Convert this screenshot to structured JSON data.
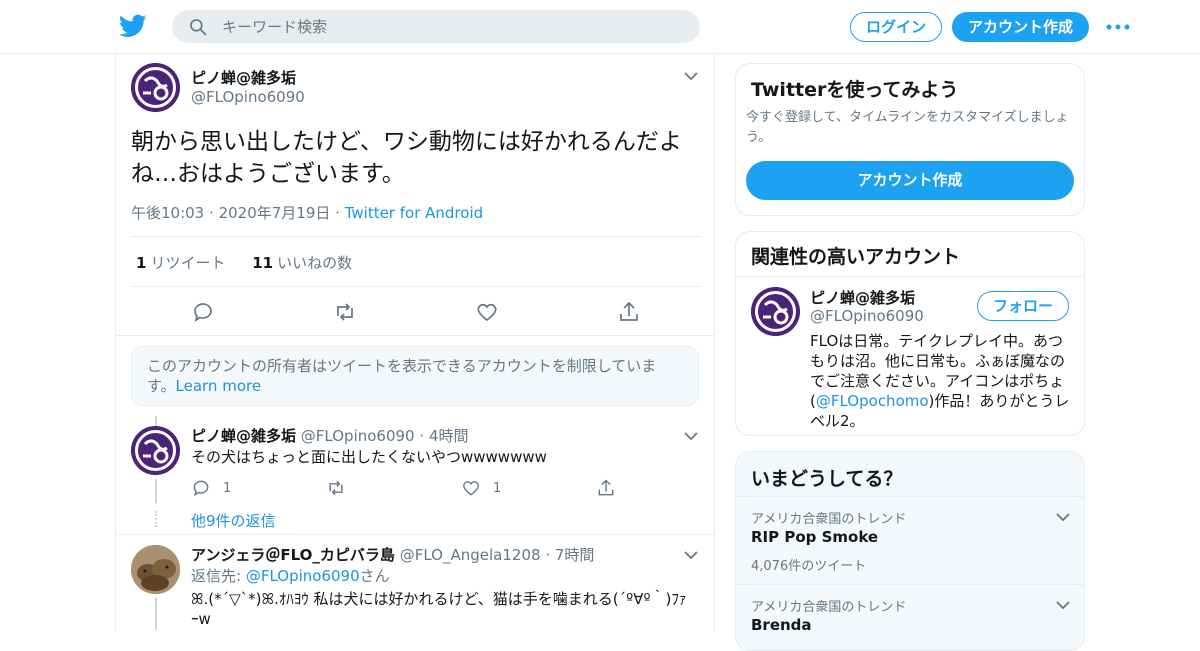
{
  "header": {
    "search_placeholder": "キーワード検索",
    "login_label": "ログイン",
    "signup_label": "アカウント作成",
    "brand_color": "#1da1f2"
  },
  "focal_tweet": {
    "author_name": "ピノ蝉@雑多垢",
    "author_handle": "@FLOpino6090",
    "text": "朝から思い出したけど、ワシ動物には好かれるんだよね…おはようございます。",
    "time": "午後10:03",
    "date": "2020年7月19日",
    "source": "Twitter for Android",
    "retweet_count": "1",
    "retweet_label": "リツイート",
    "like_count": "11",
    "like_label": "いいねの数"
  },
  "notice": {
    "text": "このアカウントの所有者はツイートを表示できるアカウントを制限しています。",
    "link": "Learn more"
  },
  "replies": [
    {
      "author_name": "ピノ蝉@雑多垢",
      "author_handle": "@FLOpino6090",
      "time": "4時間",
      "text": "その犬はちょっと面に出したくないやつwwwwwww",
      "reply_count": "1",
      "like_count": "1",
      "more_replies": "他9件の返信"
    },
    {
      "author_name": "アンジェラ＠FLO_カピバラ島",
      "author_handle": "@FLO_Angela1208",
      "time": "7時間",
      "reply_to_label": "返信先:",
      "reply_to_handle": "@FLOpino6090",
      "reply_to_suffix": "さん",
      "text": "ꕤ.(*´▽`*)ꕤ.ｵﾊﾖｳ 私は犬には好かれるけど、猫は手を噛まれる(´º∀º｀)ﾌｧｰw"
    }
  ],
  "sidebar": {
    "try_card": {
      "title": "Twitterを使ってみよう",
      "subtitle": "今すぐ登録して、タイムラインをカスタマイズしましょう。",
      "button": "アカウント作成"
    },
    "related_card": {
      "title": "関連性の高いアカウント",
      "name": "ピノ蝉@雑多垢",
      "handle": "@FLOpino6090",
      "follow_label": "フォロー",
      "bio_before": "FLOは日常。テイクレプレイ中。あつもりは沼。他に日常も。ふぁぼ魔なのでご注意ください。アイコンはポちょ(",
      "bio_link": "@FLOpochomo",
      "bio_after": ")作品！ありがとうレベル2。"
    },
    "trends_card": {
      "title": "いまどうしてる？",
      "trends": [
        {
          "context": "アメリカ合衆国のトレンド",
          "name": "RIP Pop Smoke",
          "count": "4,076件のツイート"
        },
        {
          "context": "アメリカ合衆国のトレンド",
          "name": "Brenda",
          "count": ""
        }
      ]
    }
  }
}
